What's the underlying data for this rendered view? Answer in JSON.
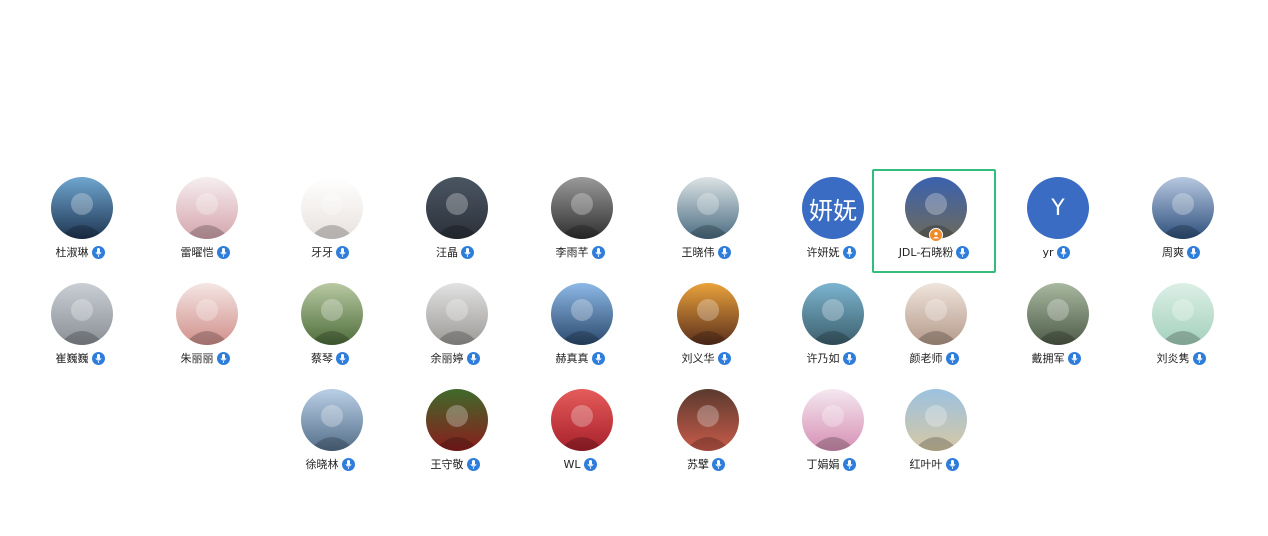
{
  "participants": [
    {
      "name": "杜淑琳",
      "avatar_icon": "photo-woman-icon",
      "bg": [
        "#6fa6cf",
        "#1f3552"
      ],
      "row": 0,
      "col": 0
    },
    {
      "name": "雷曜恺",
      "avatar_icon": "photo-cartoon-icon",
      "bg": [
        "#f6eef0",
        "#d4a5ad"
      ],
      "row": 0,
      "col": 1
    },
    {
      "name": "牙牙",
      "avatar_icon": "photo-cartoon-girl-icon",
      "bg": [
        "#ffffff",
        "#e8e2de"
      ],
      "row": 0,
      "col": 2
    },
    {
      "name": "汪晶",
      "avatar_icon": "photo-painting-icon",
      "bg": [
        "#4b5663",
        "#2b313a"
      ],
      "row": 0,
      "col": 3
    },
    {
      "name": "李雨芊",
      "avatar_icon": "photo-building-icon",
      "bg": [
        "#9a9a9a",
        "#2f2f2f"
      ],
      "row": 0,
      "col": 4
    },
    {
      "name": "王晓伟",
      "avatar_icon": "photo-child-icon",
      "bg": [
        "#dce3e5",
        "#4a6c82"
      ],
      "row": 0,
      "col": 5
    },
    {
      "name": "许妍妩",
      "avatar_icon": "initial-avatar-icon",
      "initial": "妍妩",
      "bg": [
        "#3a6cc3",
        "#3a6cc3"
      ],
      "row": 0,
      "col": 6
    },
    {
      "name": "JDL-石晓粉",
      "avatar_icon": "photo-street-icon",
      "bg": [
        "#3a62b0",
        "#6d6a5c"
      ],
      "row": 0,
      "col": 7,
      "active": true,
      "host": true
    },
    {
      "name": "yr",
      "avatar_icon": "initial-avatar-icon",
      "initial": "Y",
      "bg": [
        "#3a6cc3",
        "#3a6cc3"
      ],
      "row": 0,
      "col": 8
    },
    {
      "name": "周爽",
      "avatar_icon": "photo-sea-icon",
      "bg": [
        "#b7c8e0",
        "#2d4f7c"
      ],
      "row": 0,
      "col": 9
    },
    {
      "name": "崔巍巍",
      "avatar_icon": "photo-indoor-icon",
      "bg": [
        "#c9cfd4",
        "#8a8f96"
      ],
      "row": 1,
      "col": 0
    },
    {
      "name": "朱丽丽",
      "avatar_icon": "photo-woman-icon",
      "bg": [
        "#f4e6e4",
        "#d18f8b"
      ],
      "row": 1,
      "col": 1
    },
    {
      "name": "蔡琴",
      "avatar_icon": "photo-garden-icon",
      "bg": [
        "#b8c9a3",
        "#4e6d3a"
      ],
      "row": 1,
      "col": 2
    },
    {
      "name": "余丽婷",
      "avatar_icon": "photo-cat-icon",
      "bg": [
        "#e2e2e2",
        "#9c9a97"
      ],
      "row": 1,
      "col": 3
    },
    {
      "name": "赫真真",
      "avatar_icon": "photo-sky-icon",
      "bg": [
        "#8db8e6",
        "#2b4a6e"
      ],
      "row": 1,
      "col": 4
    },
    {
      "name": "刘义华",
      "avatar_icon": "photo-flower-girl-icon",
      "bg": [
        "#e9a23b",
        "#5b2f1c"
      ],
      "row": 1,
      "col": 5
    },
    {
      "name": "许乃如",
      "avatar_icon": "photo-mountain-lake-icon",
      "bg": [
        "#7cb4cf",
        "#3c5f6d"
      ],
      "row": 1,
      "col": 6
    },
    {
      "name": "颜老师",
      "avatar_icon": "photo-baby-icon",
      "bg": [
        "#efe4dc",
        "#b59a8a"
      ],
      "row": 1,
      "col": 7
    },
    {
      "name": "戴拥军",
      "avatar_icon": "photo-willow-icon",
      "bg": [
        "#a9b9a0",
        "#4d5b48"
      ],
      "row": 1,
      "col": 8
    },
    {
      "name": "刘炎隽",
      "avatar_icon": "photo-cartoon-girl-icon",
      "bg": [
        "#dcefe6",
        "#a4d1bd"
      ],
      "row": 1,
      "col": 9
    },
    {
      "name": "徐晓林",
      "avatar_icon": "photo-sea-icon",
      "bg": [
        "#b9cfe6",
        "#556f8a"
      ],
      "row": 2,
      "col": 2
    },
    {
      "name": "王守敬",
      "avatar_icon": "photo-roses-icon",
      "bg": [
        "#3f6a2b",
        "#8a1d1d"
      ],
      "row": 2,
      "col": 3
    },
    {
      "name": "WL",
      "avatar_icon": "photo-heart-icon",
      "bg": [
        "#e65c5c",
        "#a8202a"
      ],
      "row": 2,
      "col": 4
    },
    {
      "name": "苏擘",
      "avatar_icon": "photo-child-icon",
      "bg": [
        "#5a3a2e",
        "#c95b4a"
      ],
      "row": 2,
      "col": 5
    },
    {
      "name": "丁娟娟",
      "avatar_icon": "photo-dancer-icon",
      "bg": [
        "#f4e8f0",
        "#d68fb4"
      ],
      "row": 2,
      "col": 6
    },
    {
      "name": "红叶叶",
      "avatar_icon": "photo-lake-woman-icon",
      "bg": [
        "#9cc2e0",
        "#d6c7a4"
      ],
      "row": 2,
      "col": 7
    }
  ],
  "colors": {
    "active_border": "#33bd7c",
    "mic_badge": "#2f7ddb",
    "host_badge": "#f08b2b"
  }
}
